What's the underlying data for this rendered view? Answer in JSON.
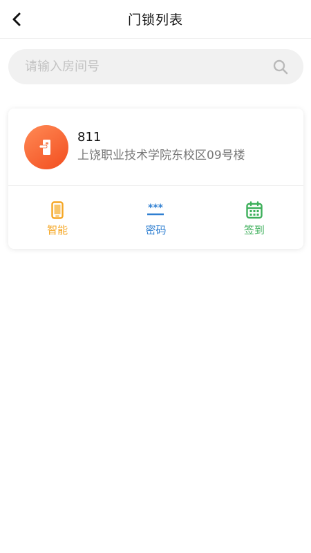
{
  "header": {
    "title": "门锁列表"
  },
  "search": {
    "placeholder": "请输入房间号",
    "value": ""
  },
  "locks": [
    {
      "room": "811",
      "address": "上饶职业技术学院东校区09号楼",
      "actions": [
        {
          "label": "智能",
          "icon": "phone-icon",
          "color": "#f5a623"
        },
        {
          "label": "密码",
          "icon": "password-icon",
          "color": "#2f7fd1"
        },
        {
          "label": "签到",
          "icon": "calendar-icon",
          "color": "#3daf5a"
        }
      ]
    }
  ],
  "colors": {
    "avatar_gradient_start": "#ff8a55",
    "avatar_gradient_end": "#f24d1f"
  }
}
